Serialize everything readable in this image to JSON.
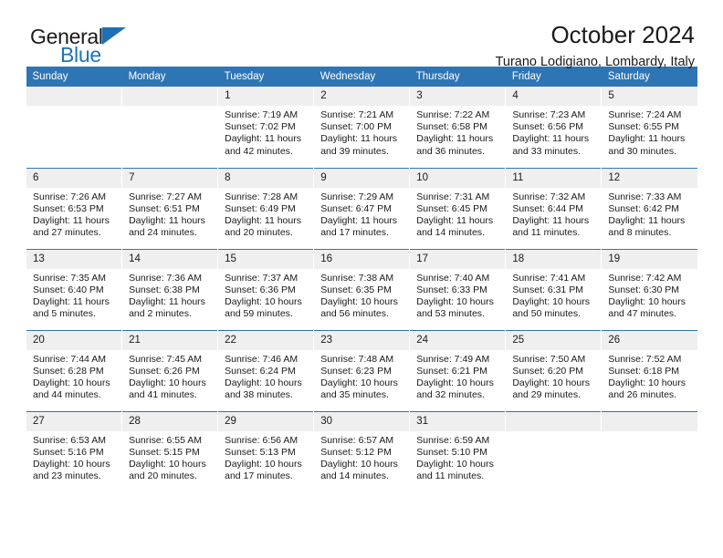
{
  "brand": {
    "name_top": "General",
    "name_bottom": "Blue",
    "accent_color": "#2072b8"
  },
  "header": {
    "title": "October 2024",
    "location": "Turano Lodigiano, Lombardy, Italy"
  },
  "theme": {
    "header_blue": "#2e75b6",
    "daynum_band": "#efefef",
    "text": "#1a1a1a"
  },
  "weekday_headers": [
    "Sunday",
    "Monday",
    "Tuesday",
    "Wednesday",
    "Thursday",
    "Friday",
    "Saturday"
  ],
  "labels": {
    "sunrise_prefix": "Sunrise:",
    "sunset_prefix": "Sunset:",
    "daylight_prefix": "Daylight:"
  },
  "weeks": [
    [
      {
        "day": "",
        "sunrise": "",
        "sunset": "",
        "daylight_line1": "",
        "daylight_line2": ""
      },
      {
        "day": "",
        "sunrise": "",
        "sunset": "",
        "daylight_line1": "",
        "daylight_line2": ""
      },
      {
        "day": "1",
        "sunrise": "Sunrise: 7:19 AM",
        "sunset": "Sunset: 7:02 PM",
        "daylight_line1": "Daylight: 11 hours",
        "daylight_line2": "and 42 minutes."
      },
      {
        "day": "2",
        "sunrise": "Sunrise: 7:21 AM",
        "sunset": "Sunset: 7:00 PM",
        "daylight_line1": "Daylight: 11 hours",
        "daylight_line2": "and 39 minutes."
      },
      {
        "day": "3",
        "sunrise": "Sunrise: 7:22 AM",
        "sunset": "Sunset: 6:58 PM",
        "daylight_line1": "Daylight: 11 hours",
        "daylight_line2": "and 36 minutes."
      },
      {
        "day": "4",
        "sunrise": "Sunrise: 7:23 AM",
        "sunset": "Sunset: 6:56 PM",
        "daylight_line1": "Daylight: 11 hours",
        "daylight_line2": "and 33 minutes."
      },
      {
        "day": "5",
        "sunrise": "Sunrise: 7:24 AM",
        "sunset": "Sunset: 6:55 PM",
        "daylight_line1": "Daylight: 11 hours",
        "daylight_line2": "and 30 minutes."
      }
    ],
    [
      {
        "day": "6",
        "sunrise": "Sunrise: 7:26 AM",
        "sunset": "Sunset: 6:53 PM",
        "daylight_line1": "Daylight: 11 hours",
        "daylight_line2": "and 27 minutes."
      },
      {
        "day": "7",
        "sunrise": "Sunrise: 7:27 AM",
        "sunset": "Sunset: 6:51 PM",
        "daylight_line1": "Daylight: 11 hours",
        "daylight_line2": "and 24 minutes."
      },
      {
        "day": "8",
        "sunrise": "Sunrise: 7:28 AM",
        "sunset": "Sunset: 6:49 PM",
        "daylight_line1": "Daylight: 11 hours",
        "daylight_line2": "and 20 minutes."
      },
      {
        "day": "9",
        "sunrise": "Sunrise: 7:29 AM",
        "sunset": "Sunset: 6:47 PM",
        "daylight_line1": "Daylight: 11 hours",
        "daylight_line2": "and 17 minutes."
      },
      {
        "day": "10",
        "sunrise": "Sunrise: 7:31 AM",
        "sunset": "Sunset: 6:45 PM",
        "daylight_line1": "Daylight: 11 hours",
        "daylight_line2": "and 14 minutes."
      },
      {
        "day": "11",
        "sunrise": "Sunrise: 7:32 AM",
        "sunset": "Sunset: 6:44 PM",
        "daylight_line1": "Daylight: 11 hours",
        "daylight_line2": "and 11 minutes."
      },
      {
        "day": "12",
        "sunrise": "Sunrise: 7:33 AM",
        "sunset": "Sunset: 6:42 PM",
        "daylight_line1": "Daylight: 11 hours",
        "daylight_line2": "and 8 minutes."
      }
    ],
    [
      {
        "day": "13",
        "sunrise": "Sunrise: 7:35 AM",
        "sunset": "Sunset: 6:40 PM",
        "daylight_line1": "Daylight: 11 hours",
        "daylight_line2": "and 5 minutes."
      },
      {
        "day": "14",
        "sunrise": "Sunrise: 7:36 AM",
        "sunset": "Sunset: 6:38 PM",
        "daylight_line1": "Daylight: 11 hours",
        "daylight_line2": "and 2 minutes."
      },
      {
        "day": "15",
        "sunrise": "Sunrise: 7:37 AM",
        "sunset": "Sunset: 6:36 PM",
        "daylight_line1": "Daylight: 10 hours",
        "daylight_line2": "and 59 minutes."
      },
      {
        "day": "16",
        "sunrise": "Sunrise: 7:38 AM",
        "sunset": "Sunset: 6:35 PM",
        "daylight_line1": "Daylight: 10 hours",
        "daylight_line2": "and 56 minutes."
      },
      {
        "day": "17",
        "sunrise": "Sunrise: 7:40 AM",
        "sunset": "Sunset: 6:33 PM",
        "daylight_line1": "Daylight: 10 hours",
        "daylight_line2": "and 53 minutes."
      },
      {
        "day": "18",
        "sunrise": "Sunrise: 7:41 AM",
        "sunset": "Sunset: 6:31 PM",
        "daylight_line1": "Daylight: 10 hours",
        "daylight_line2": "and 50 minutes."
      },
      {
        "day": "19",
        "sunrise": "Sunrise: 7:42 AM",
        "sunset": "Sunset: 6:30 PM",
        "daylight_line1": "Daylight: 10 hours",
        "daylight_line2": "and 47 minutes."
      }
    ],
    [
      {
        "day": "20",
        "sunrise": "Sunrise: 7:44 AM",
        "sunset": "Sunset: 6:28 PM",
        "daylight_line1": "Daylight: 10 hours",
        "daylight_line2": "and 44 minutes."
      },
      {
        "day": "21",
        "sunrise": "Sunrise: 7:45 AM",
        "sunset": "Sunset: 6:26 PM",
        "daylight_line1": "Daylight: 10 hours",
        "daylight_line2": "and 41 minutes."
      },
      {
        "day": "22",
        "sunrise": "Sunrise: 7:46 AM",
        "sunset": "Sunset: 6:24 PM",
        "daylight_line1": "Daylight: 10 hours",
        "daylight_line2": "and 38 minutes."
      },
      {
        "day": "23",
        "sunrise": "Sunrise: 7:48 AM",
        "sunset": "Sunset: 6:23 PM",
        "daylight_line1": "Daylight: 10 hours",
        "daylight_line2": "and 35 minutes."
      },
      {
        "day": "24",
        "sunrise": "Sunrise: 7:49 AM",
        "sunset": "Sunset: 6:21 PM",
        "daylight_line1": "Daylight: 10 hours",
        "daylight_line2": "and 32 minutes."
      },
      {
        "day": "25",
        "sunrise": "Sunrise: 7:50 AM",
        "sunset": "Sunset: 6:20 PM",
        "daylight_line1": "Daylight: 10 hours",
        "daylight_line2": "and 29 minutes."
      },
      {
        "day": "26",
        "sunrise": "Sunrise: 7:52 AM",
        "sunset": "Sunset: 6:18 PM",
        "daylight_line1": "Daylight: 10 hours",
        "daylight_line2": "and 26 minutes."
      }
    ],
    [
      {
        "day": "27",
        "sunrise": "Sunrise: 6:53 AM",
        "sunset": "Sunset: 5:16 PM",
        "daylight_line1": "Daylight: 10 hours",
        "daylight_line2": "and 23 minutes."
      },
      {
        "day": "28",
        "sunrise": "Sunrise: 6:55 AM",
        "sunset": "Sunset: 5:15 PM",
        "daylight_line1": "Daylight: 10 hours",
        "daylight_line2": "and 20 minutes."
      },
      {
        "day": "29",
        "sunrise": "Sunrise: 6:56 AM",
        "sunset": "Sunset: 5:13 PM",
        "daylight_line1": "Daylight: 10 hours",
        "daylight_line2": "and 17 minutes."
      },
      {
        "day": "30",
        "sunrise": "Sunrise: 6:57 AM",
        "sunset": "Sunset: 5:12 PM",
        "daylight_line1": "Daylight: 10 hours",
        "daylight_line2": "and 14 minutes."
      },
      {
        "day": "31",
        "sunrise": "Sunrise: 6:59 AM",
        "sunset": "Sunset: 5:10 PM",
        "daylight_line1": "Daylight: 10 hours",
        "daylight_line2": "and 11 minutes."
      },
      {
        "day": "",
        "sunrise": "",
        "sunset": "",
        "daylight_line1": "",
        "daylight_line2": ""
      },
      {
        "day": "",
        "sunrise": "",
        "sunset": "",
        "daylight_line1": "",
        "daylight_line2": ""
      }
    ]
  ]
}
